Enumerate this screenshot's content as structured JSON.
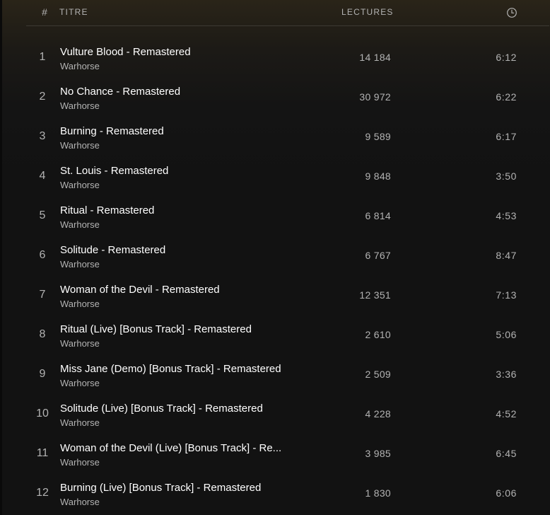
{
  "header": {
    "number": "#",
    "title": "TITRE",
    "plays": "LECTURES",
    "duration_icon": "clock-icon"
  },
  "tracks": [
    {
      "number": "1",
      "title": "Vulture Blood - Remastered",
      "artist": "Warhorse",
      "plays": "14 184",
      "duration": "6:12"
    },
    {
      "number": "2",
      "title": "No Chance - Remastered",
      "artist": "Warhorse",
      "plays": "30 972",
      "duration": "6:22"
    },
    {
      "number": "3",
      "title": "Burning - Remastered",
      "artist": "Warhorse",
      "plays": "9 589",
      "duration": "6:17"
    },
    {
      "number": "4",
      "title": "St. Louis - Remastered",
      "artist": "Warhorse",
      "plays": "9 848",
      "duration": "3:50"
    },
    {
      "number": "5",
      "title": "Ritual - Remastered",
      "artist": "Warhorse",
      "plays": "6 814",
      "duration": "4:53"
    },
    {
      "number": "6",
      "title": "Solitude - Remastered",
      "artist": "Warhorse",
      "plays": "6 767",
      "duration": "8:47"
    },
    {
      "number": "7",
      "title": "Woman of the Devil - Remastered",
      "artist": "Warhorse",
      "plays": "12 351",
      "duration": "7:13"
    },
    {
      "number": "8",
      "title": "Ritual (Live) [Bonus Track] - Remastered",
      "artist": "Warhorse",
      "plays": "2 610",
      "duration": "5:06"
    },
    {
      "number": "9",
      "title": "Miss Jane (Demo) [Bonus Track] - Remastered",
      "artist": "Warhorse",
      "plays": "2 509",
      "duration": "3:36"
    },
    {
      "number": "10",
      "title": "Solitude (Live) [Bonus Track] - Remastered",
      "artist": "Warhorse",
      "plays": "4 228",
      "duration": "4:52"
    },
    {
      "number": "11",
      "title": "Woman of the Devil (Live) [Bonus Track] - Re...",
      "artist": "Warhorse",
      "plays": "3 985",
      "duration": "6:45"
    },
    {
      "number": "12",
      "title": "Burning (Live) [Bonus Track] - Remastered",
      "artist": "Warhorse",
      "plays": "1 830",
      "duration": "6:06"
    }
  ],
  "colors": {
    "background": "#121212",
    "text_primary": "#ffffff",
    "text_secondary": "#b3b3b3"
  }
}
